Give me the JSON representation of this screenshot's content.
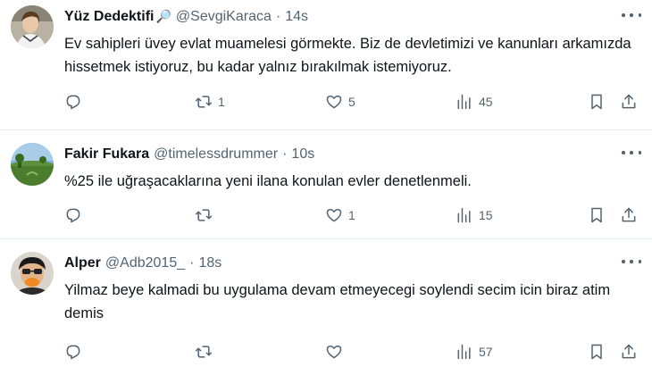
{
  "tweets": [
    {
      "name": "Yüz Dedektifi",
      "name_emoji": "🔎",
      "handle": "@SevgiKaraca",
      "dot": "·",
      "time": "14s",
      "text": "Ev sahipleri üvey evlat muamelesi görmekte. Biz de devletimizi ve kanunları arkamızda hissetmek istiyoruz, bu kadar yalnız bırakılmak istemiyoruz.",
      "replies": "",
      "retweets": "1",
      "likes": "5",
      "views": "45"
    },
    {
      "name": "Fakir Fukara",
      "handle": "@timelessdrummer",
      "dot": "·",
      "time": "10s",
      "text": "%25 ile uğraşacaklarına yeni ilana konulan evler denetlenmeli.",
      "replies": "",
      "retweets": "",
      "likes": "1",
      "views": "15"
    },
    {
      "name": "Alper",
      "handle": "@Adb2015_",
      "dot": "·",
      "time": "18s",
      "text": "Yilmaz beye kalmadi bu uygulama devam etmeyecegi soylendi secim icin biraz atim demis",
      "replies": "",
      "retweets": "",
      "likes": "",
      "views": "57"
    }
  ],
  "icons": {
    "reply": "reply-icon",
    "retweet": "retweet-icon",
    "like": "heart-icon",
    "views": "analytics-icon",
    "bookmark": "bookmark-icon",
    "share": "share-icon",
    "more": "more-icon"
  },
  "colors": {
    "text": "#0f1419",
    "secondary": "#536471",
    "divider": "#e6ecf0"
  }
}
